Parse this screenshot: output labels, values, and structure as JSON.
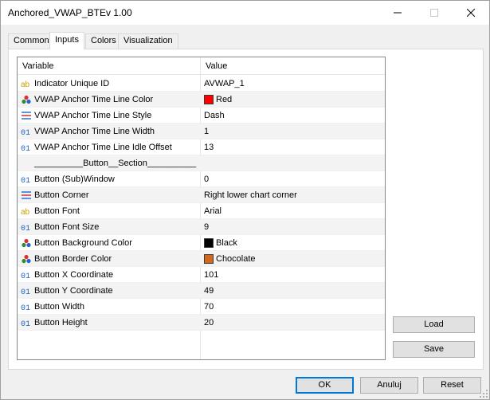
{
  "window": {
    "title": "Anchored_VWAP_BTEv 1.00"
  },
  "tabs": [
    {
      "label": "Common",
      "active": false
    },
    {
      "label": "Inputs",
      "active": true
    },
    {
      "label": "Colors",
      "active": false
    },
    {
      "label": "Visualization",
      "active": false
    }
  ],
  "grid": {
    "headers": {
      "variable": "Variable",
      "value": "Value"
    },
    "rows": [
      {
        "icon": "string-icon",
        "variable": "Indicator Unique ID",
        "value": "AVWAP_1"
      },
      {
        "icon": "color-icon",
        "variable": "VWAP Anchor Time Line Color",
        "value": "Red",
        "swatch": "#ff0000"
      },
      {
        "icon": "enum-icon",
        "variable": "VWAP Anchor Time Line Style",
        "value": "Dash"
      },
      {
        "icon": "integer-icon",
        "variable": "VWAP Anchor Time Line Width",
        "value": "1"
      },
      {
        "icon": "integer-icon",
        "variable": "VWAP Anchor Time Line Idle Offset",
        "value": "13"
      },
      {
        "icon": "none",
        "variable": "__________Button__Section__________",
        "value": ""
      },
      {
        "icon": "integer-icon",
        "variable": "Button (Sub)Window",
        "value": "0"
      },
      {
        "icon": "enum-icon",
        "variable": "Button Corner",
        "value": "Right lower chart corner"
      },
      {
        "icon": "string-icon",
        "variable": "Button Font",
        "value": "Arial"
      },
      {
        "icon": "integer-icon",
        "variable": "Button Font Size",
        "value": "9"
      },
      {
        "icon": "color-icon",
        "variable": "Button Background Color",
        "value": "Black",
        "swatch": "#000000"
      },
      {
        "icon": "color-icon",
        "variable": "Button Border Color",
        "value": "Chocolate",
        "swatch": "#d2691e"
      },
      {
        "icon": "integer-icon",
        "variable": "Button X Coordinate",
        "value": "101"
      },
      {
        "icon": "integer-icon",
        "variable": "Button Y Coordinate",
        "value": "49"
      },
      {
        "icon": "integer-icon",
        "variable": "Button Width",
        "value": "70"
      },
      {
        "icon": "integer-icon",
        "variable": "Button Height",
        "value": "20"
      }
    ]
  },
  "side_buttons": {
    "load": "Load",
    "save": "Save"
  },
  "footer": {
    "ok": "OK",
    "cancel": "Anuluj",
    "reset": "Reset"
  },
  "colors": {
    "accent": "#0078d7",
    "border": "#adadad",
    "button_bg": "#e1e1e1"
  }
}
